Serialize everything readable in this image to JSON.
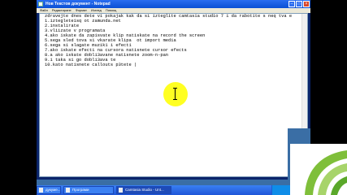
{
  "window": {
    "title": "Нов Текстов документ - Notepad"
  },
  "menu": [
    "Файл",
    "Редактиране",
    "Формат",
    "Изглед",
    "Помощ"
  ],
  "editor": {
    "lines": [
      "zdravejte dnes dete vi pokajak kak da si izteglite camtasia studio 7 i da rabotite s neq tva e",
      "1.izteglete1sq ot zamunda.net",
      "2.instalirate",
      "3.vliizate v programata",
      "4.ako iskate da zapisvate klip natiskate na record the screen",
      "5.sega sled tova si vkarate klipa  ot import media",
      "6.sega si slagate muzik1 i efecti",
      "7.ako iskate efecti na cursora natisnete cursor efects",
      "8.a ako iskate dobli3avane natisnete zoom-n-pan",
      "9.i taka si go dobli3ava te",
      "10.kato natisnete callouts p3tete |"
    ]
  },
  "taskbar": {
    "items": [
      "дукуме...",
      "Програми",
      "Camtasia Studio - Unt..."
    ]
  },
  "icons": {
    "title_app": "notepad-icon",
    "cursor": "i-beam-cursor-icon"
  },
  "colors": {
    "highlight": "#ffff22",
    "titlebar": "#0a4fd4",
    "taskbar": "#2a66e0"
  }
}
